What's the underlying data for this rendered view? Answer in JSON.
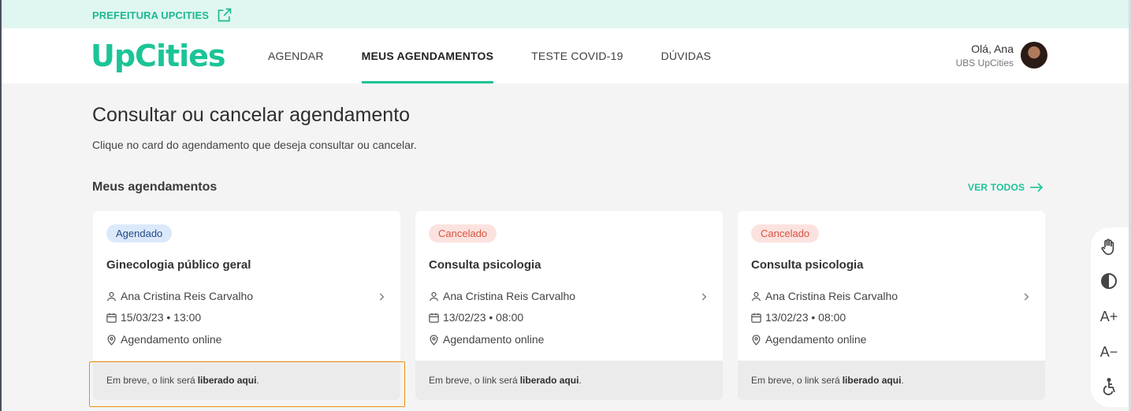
{
  "topbar": {
    "link_label": "PREFEITURA UPCITIES",
    "icon": "external-link-icon"
  },
  "header": {
    "logo": "UpCities",
    "nav": [
      {
        "label": "AGENDAR",
        "active": false
      },
      {
        "label": "MEUS AGENDAMENTOS",
        "active": true
      },
      {
        "label": "TESTE COVID-19",
        "active": false
      },
      {
        "label": "DÚVIDAS",
        "active": false
      }
    ],
    "user": {
      "greeting": "Olá, Ana",
      "unit": "UBS UpCities"
    }
  },
  "page": {
    "title": "Consultar ou cancelar agendamento",
    "subtitle": "Clique no card do agendamento que deseja consultar ou cancelar."
  },
  "section": {
    "title": "Meus agendamentos",
    "see_all": "VER TODOS"
  },
  "cards": [
    {
      "status": "Agendado",
      "title": "Ginecologia público geral",
      "patient": "Ana Cristina Reis Carvalho",
      "datetime": "15/03/23 • 13:00",
      "location": "Agendamento online",
      "foot_text": "Em breve, o link será",
      "foot_bold": "liberado aqui",
      "foot_end": "."
    },
    {
      "status": "Cancelado",
      "title": "Consulta psicologia",
      "patient": "Ana Cristina Reis Carvalho",
      "datetime": "13/02/23 • 08:00",
      "location": "Agendamento online",
      "foot_text": "Em breve, o link será",
      "foot_bold": "liberado aqui",
      "foot_end": "."
    },
    {
      "status": "Cancelado",
      "title": "Consulta psicologia",
      "patient": "Ana Cristina Reis Carvalho",
      "datetime": "13/02/23 • 08:00",
      "location": "Agendamento online",
      "foot_text": "Em breve, o link será",
      "foot_bold": "liberado aqui",
      "foot_end": "."
    }
  ],
  "accessibility": {
    "increase_font": "A+",
    "decrease_font": "A−"
  },
  "colors": {
    "brand": "#1cc497",
    "topbar_bg": "#e0f7f1",
    "scheduled_bg": "#dbe9fb",
    "canceled_bg": "#fbe2df",
    "focus": "#f0900e"
  }
}
